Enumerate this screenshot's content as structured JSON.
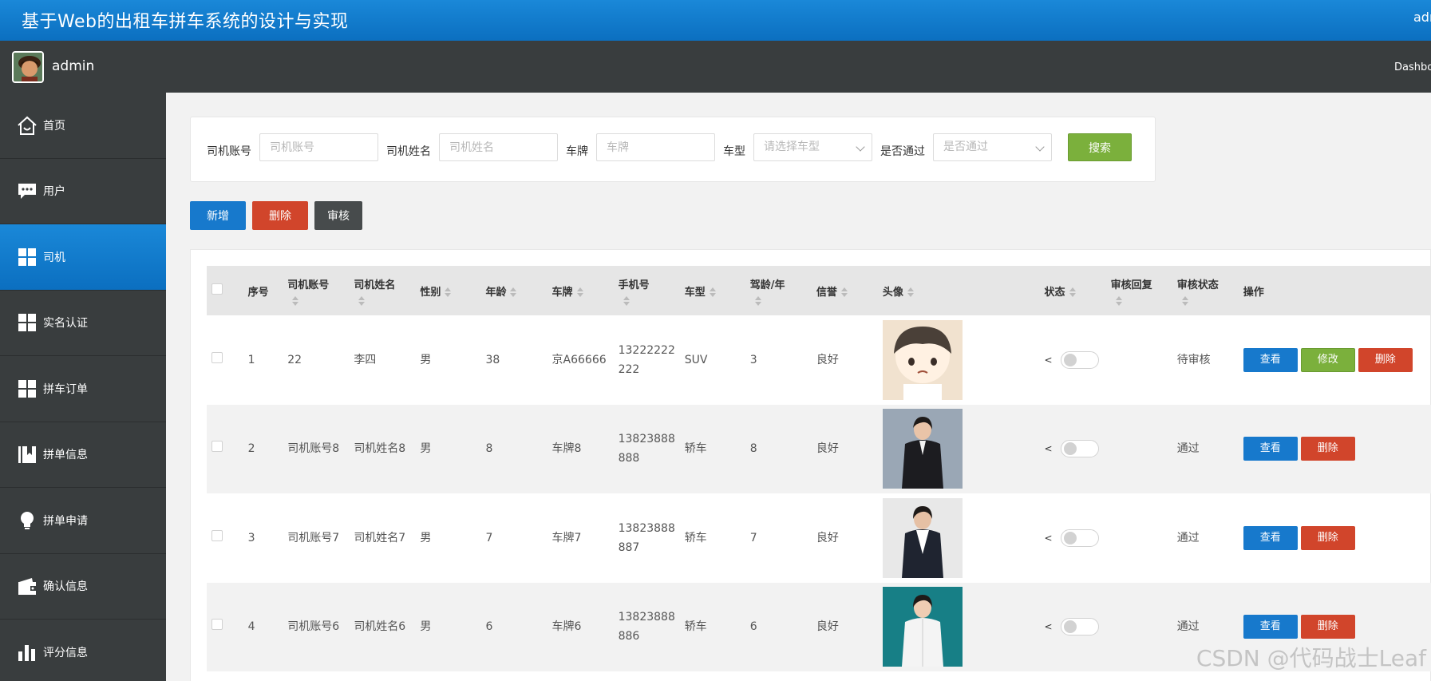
{
  "app": {
    "title": "基于Web的出租车拼车系统的设计与实现",
    "user_link": "admin"
  },
  "userbar": {
    "username": "admin",
    "dashboard": "Dashboard"
  },
  "sidebar": {
    "items": [
      {
        "label": "首页",
        "icon": "home-icon"
      },
      {
        "label": "用户",
        "icon": "chat-icon"
      },
      {
        "label": "司机",
        "icon": "grid-icon",
        "active": true
      },
      {
        "label": "实名认证",
        "icon": "grid-icon"
      },
      {
        "label": "拼车订单",
        "icon": "grid-icon"
      },
      {
        "label": "拼单信息",
        "icon": "bookmark-icon"
      },
      {
        "label": "拼单申请",
        "icon": "bulb-icon"
      },
      {
        "label": "确认信息",
        "icon": "wallet-icon"
      },
      {
        "label": "评分信息",
        "icon": "bar-chart-icon"
      }
    ]
  },
  "search": {
    "fields": [
      {
        "label": "司机账号",
        "placeholder": "司机账号"
      },
      {
        "label": "司机姓名",
        "placeholder": "司机姓名"
      },
      {
        "label": "车牌",
        "placeholder": "车牌"
      }
    ],
    "selects": [
      {
        "label": "车型",
        "placeholder": "请选择车型"
      },
      {
        "label": "是否通过",
        "placeholder": "是否通过"
      }
    ],
    "button": "搜索"
  },
  "actions": {
    "add": "新增",
    "delete": "删除",
    "audit": "审核"
  },
  "table": {
    "headers": [
      "序号",
      "司机账号",
      "司机姓名",
      "性别",
      "年龄",
      "车牌",
      "手机号",
      "车型",
      "驾龄/年",
      "信誉",
      "头像",
      "状态",
      "审核回复",
      "审核状态",
      "操作"
    ],
    "rows": [
      {
        "no": "1",
        "account": "22",
        "name": "李四",
        "gender": "男",
        "age": "38",
        "plate": "京A66666",
        "phone": "13222222222",
        "type": "SUV",
        "years": "3",
        "credit": "良好",
        "reply": "",
        "audit": "待审核",
        "ops": [
          "查看",
          "修改",
          "删除"
        ]
      },
      {
        "no": "2",
        "account": "司机账号8",
        "name": "司机姓名8",
        "gender": "男",
        "age": "8",
        "plate": "车牌8",
        "phone": "13823888888",
        "type": "轿车",
        "years": "8",
        "credit": "良好",
        "reply": "",
        "audit": "通过",
        "ops": [
          "查看",
          "删除"
        ]
      },
      {
        "no": "3",
        "account": "司机账号7",
        "name": "司机姓名7",
        "gender": "男",
        "age": "7",
        "plate": "车牌7",
        "phone": "13823888887",
        "type": "轿车",
        "years": "7",
        "credit": "良好",
        "reply": "",
        "audit": "通过",
        "ops": [
          "查看",
          "删除"
        ]
      },
      {
        "no": "4",
        "account": "司机账号6",
        "name": "司机姓名6",
        "gender": "男",
        "age": "6",
        "plate": "车牌6",
        "phone": "13823888886",
        "type": "轿车",
        "years": "6",
        "credit": "良好",
        "reply": "",
        "audit": "通过",
        "ops": [
          "查看",
          "删除"
        ]
      }
    ]
  },
  "watermark": "CSDN @代码战士Leaf",
  "colors": {
    "primary": "#1779cc",
    "danger": "#d1452b",
    "success": "#7bb03c",
    "sidebar": "#393d3e"
  }
}
